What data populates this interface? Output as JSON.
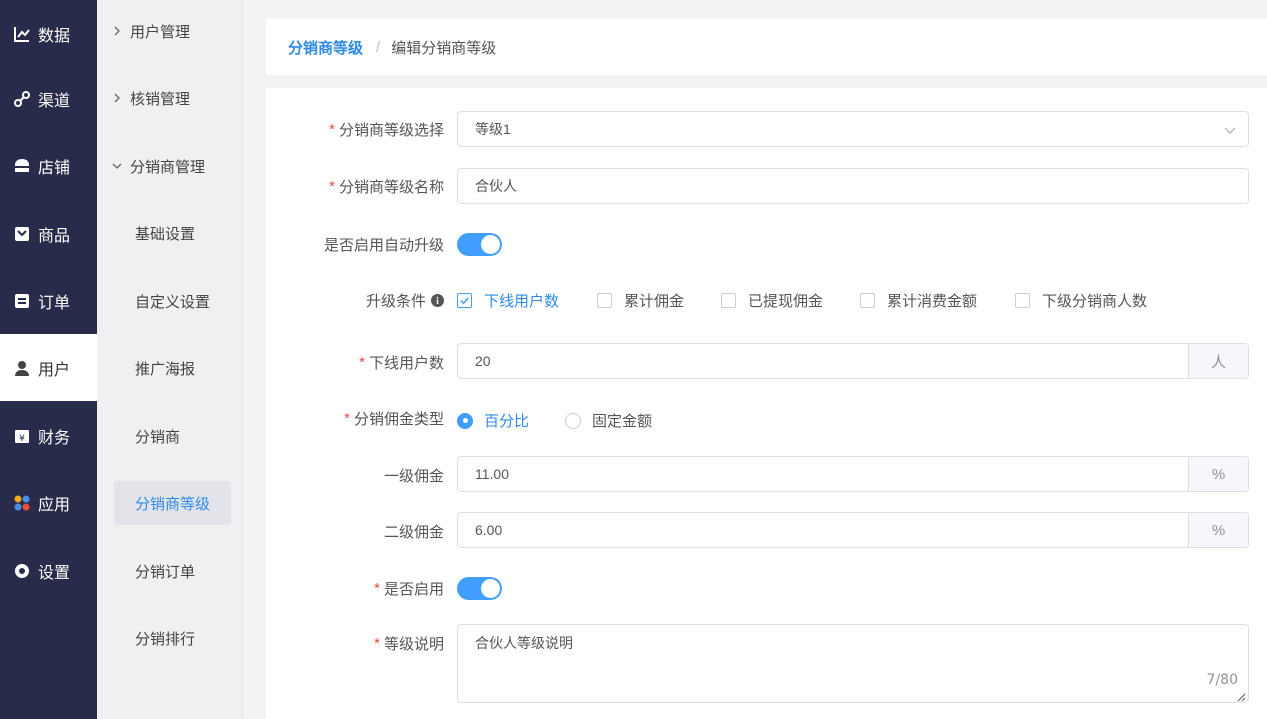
{
  "nav": {
    "items": [
      {
        "label": "数据",
        "icon": "line-chart-icon"
      },
      {
        "label": "渠道",
        "icon": "link-icon"
      },
      {
        "label": "店铺",
        "icon": "store-icon"
      },
      {
        "label": "商品",
        "icon": "goods-icon"
      },
      {
        "label": "订单",
        "icon": "order-icon"
      },
      {
        "label": "用户",
        "icon": "user-icon",
        "active": true
      },
      {
        "label": "财务",
        "icon": "finance-icon"
      },
      {
        "label": "应用",
        "icon": "apps-icon"
      },
      {
        "label": "设置",
        "icon": "settings-icon"
      }
    ]
  },
  "subnav": {
    "groups": [
      {
        "label": "用户管理",
        "expanded": false
      },
      {
        "label": "核销管理",
        "expanded": false
      },
      {
        "label": "分销商管理",
        "expanded": true
      }
    ],
    "items": [
      {
        "label": "基础设置"
      },
      {
        "label": "自定义设置"
      },
      {
        "label": "推广海报"
      },
      {
        "label": "分销商"
      },
      {
        "label": "分销商等级",
        "active": true
      },
      {
        "label": "分销订单"
      },
      {
        "label": "分销排行"
      }
    ]
  },
  "breadcrumb": {
    "parent": "分销商等级",
    "separator": "/",
    "current": "编辑分销商等级"
  },
  "form": {
    "level_select": {
      "label": "分销商等级选择",
      "value": "等级1"
    },
    "level_name": {
      "label": "分销商等级名称",
      "value": "合伙人"
    },
    "auto_upgrade": {
      "label": "是否启用自动升级",
      "on": true
    },
    "upgrade_conditions": {
      "label": "升级条件",
      "options": [
        {
          "label": "下线用户数",
          "checked": true
        },
        {
          "label": "累计佣金",
          "checked": false
        },
        {
          "label": "已提现佣金",
          "checked": false
        },
        {
          "label": "累计消费金额",
          "checked": false
        },
        {
          "label": "下级分销商人数",
          "checked": false
        }
      ]
    },
    "downline_users": {
      "label": "下线用户数",
      "value": "20",
      "unit": "人"
    },
    "commission_type": {
      "label": "分销佣金类型",
      "options": [
        {
          "label": "百分比",
          "checked": true
        },
        {
          "label": "固定金额",
          "checked": false
        }
      ]
    },
    "level1_commission": {
      "label": "一级佣金",
      "value": "11.00",
      "unit": "%"
    },
    "level2_commission": {
      "label": "二级佣金",
      "value": "6.00",
      "unit": "%"
    },
    "enabled": {
      "label": "是否启用",
      "on": true
    },
    "description": {
      "label": "等级说明",
      "value": "合伙人等级说明",
      "counter": "7/80"
    }
  },
  "colors": {
    "nav_bg": "#282c4a",
    "accent": "#409eff",
    "link": "#2e8ae6",
    "required": "#f04848"
  }
}
